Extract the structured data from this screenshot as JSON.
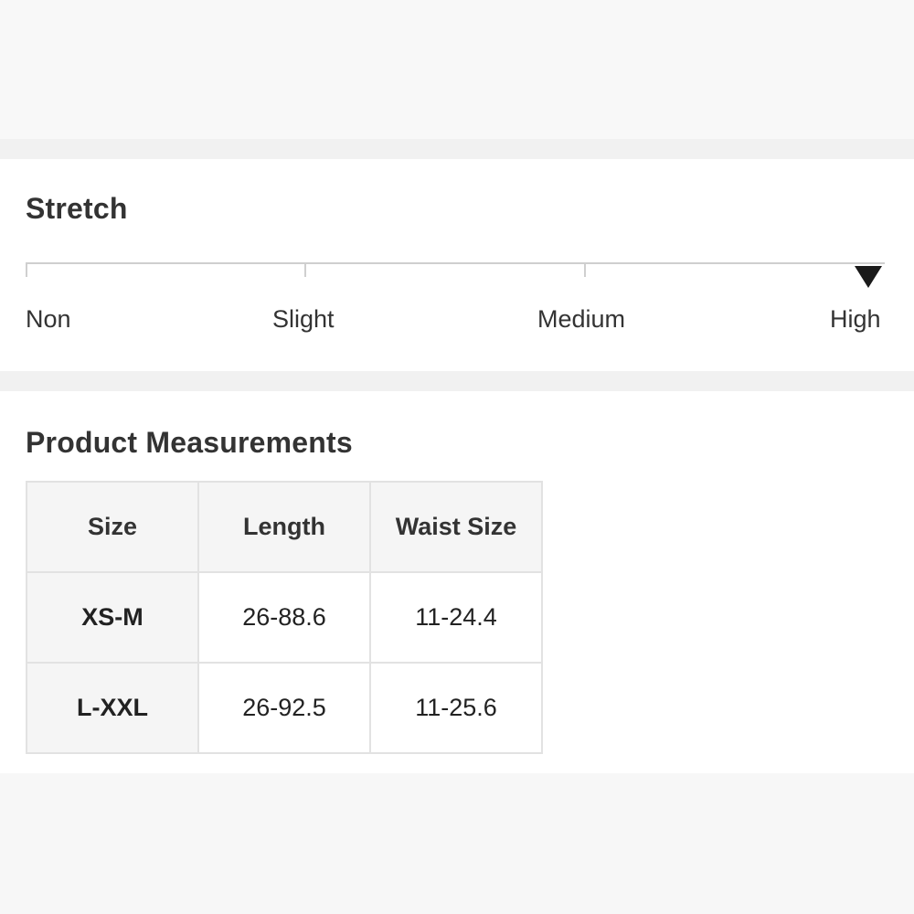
{
  "stretch": {
    "title": "Stretch",
    "levels": [
      "Non",
      "Slight",
      "Medium",
      "High"
    ],
    "selected_level": "High"
  },
  "measurements": {
    "title": "Product Measurements",
    "columns": [
      "Size",
      "Length",
      "Waist Size"
    ],
    "rows": [
      [
        "XS-M",
        "26-88.6",
        "11-24.4"
      ],
      [
        "L-XXL",
        "26-92.5",
        "11-25.6"
      ]
    ]
  }
}
